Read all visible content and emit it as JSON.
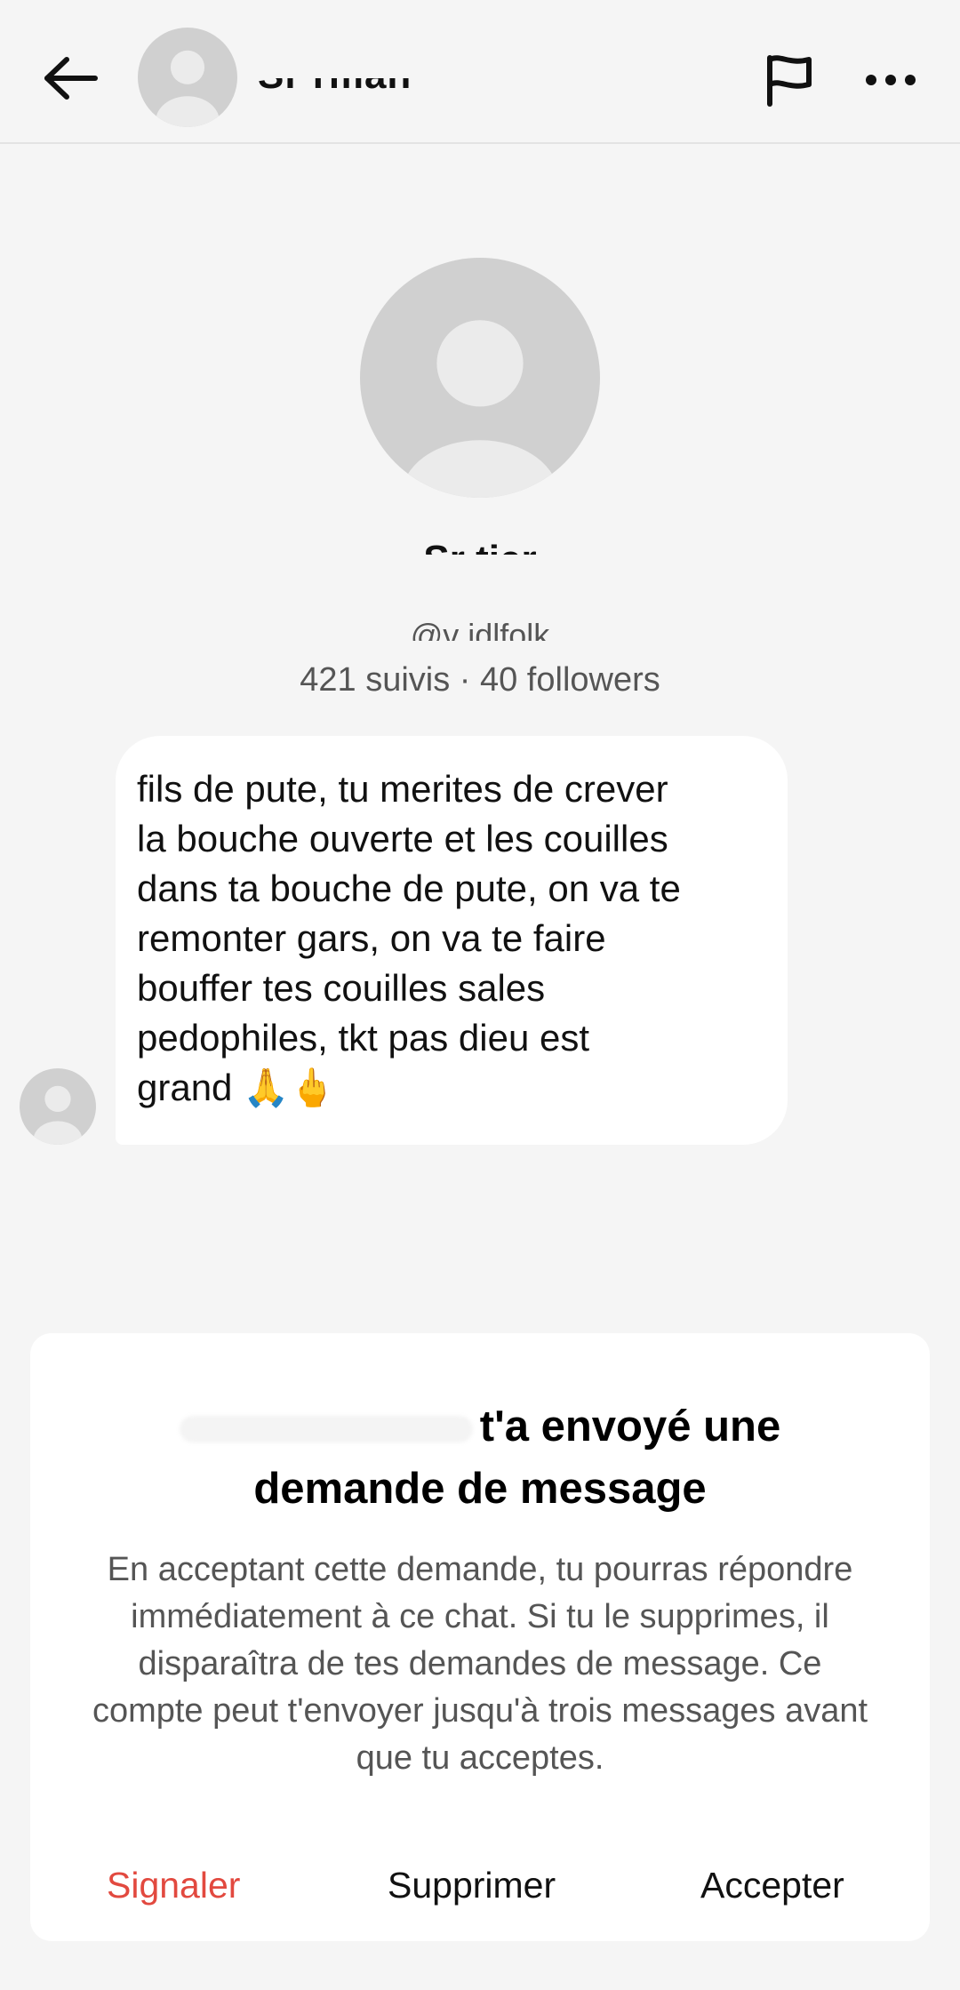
{
  "colors": {
    "background": "#f5f5f5",
    "bubble": "#ffffff",
    "report_red": "#e2493f",
    "avatar_grey": "#d0d0d0"
  },
  "header": {
    "back_icon": "arrow-left-icon",
    "name": "Sr     rman",
    "flag_icon": "flag-icon",
    "more_icon": "more-horizontal-icon"
  },
  "profile": {
    "avatar_icon": "default-avatar-icon",
    "name": "Sr     tier",
    "username": "@v    idlfolk",
    "stats": "421 suivis · 40 followers"
  },
  "message": {
    "text": "fils de pute, tu merites de crever\nla bouche ouverte et les couilles\ndans ta bouche de pute, on va te\nremonter gars, on va te faire\nbouffer tes couilles sales\npedophiles, tkt pas dieu est\ngrand ",
    "emojis": "🙏🖕"
  },
  "request_sheet": {
    "title_line1": "t'a envoyé une",
    "title_line2": "demande de message",
    "body": "En acceptant cette demande, tu pourras répondre immédiatement à ce chat. Si tu le supprimes, il disparaîtra de tes demandes de message. Ce compte peut t'envoyer jusqu'à trois messages avant que tu acceptes.",
    "actions": {
      "report": "Signaler",
      "delete": "Supprimer",
      "accept": "Accepter"
    }
  }
}
